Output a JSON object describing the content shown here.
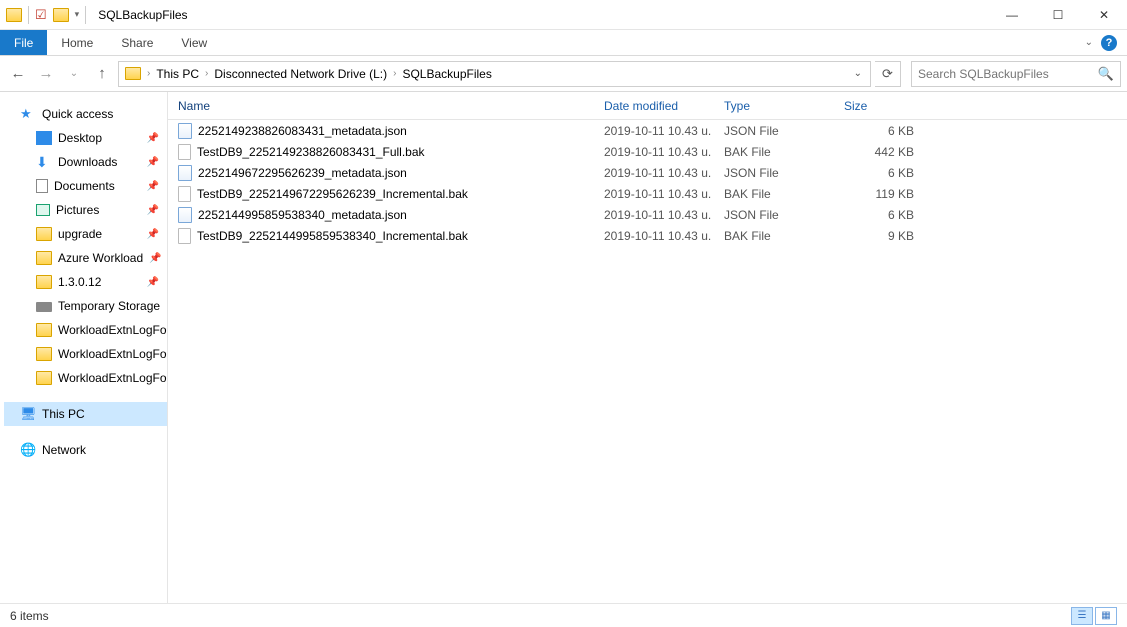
{
  "window": {
    "title": "SQLBackupFiles"
  },
  "ribbon": {
    "tabs": {
      "file": "File",
      "home": "Home",
      "share": "Share",
      "view": "View"
    }
  },
  "breadcrumb": {
    "parts": [
      "This PC",
      "Disconnected Network Drive (L:)",
      "SQLBackupFiles"
    ]
  },
  "search": {
    "placeholder": "Search SQLBackupFiles"
  },
  "tree": {
    "quick_access": "Quick access",
    "desktop": "Desktop",
    "downloads": "Downloads",
    "documents": "Documents",
    "pictures": "Pictures",
    "upgrade": "upgrade",
    "azure": "Azure Workload",
    "ver": "1.3.0.12",
    "temp": "Temporary Storage",
    "wl1": "WorkloadExtnLogFo",
    "wl2": "WorkloadExtnLogFo",
    "wl3": "WorkloadExtnLogFo",
    "this_pc": "This PC",
    "network": "Network"
  },
  "columns": {
    "name": "Name",
    "date": "Date modified",
    "type": "Type",
    "size": "Size"
  },
  "files": [
    {
      "name": "2252149238826083431_metadata.json",
      "date": "2019-10-11 10.43 u.",
      "type": "JSON File",
      "size": "6 KB",
      "icon": "json"
    },
    {
      "name": "TestDB9_2252149238826083431_Full.bak",
      "date": "2019-10-11 10.43 u.",
      "type": "BAK File",
      "size": "442 KB",
      "icon": "bak"
    },
    {
      "name": "2252149672295626239_metadata.json",
      "date": "2019-10-11 10.43 u.",
      "type": "JSON File",
      "size": "6 KB",
      "icon": "json"
    },
    {
      "name": "TestDB9_2252149672295626239_Incremental.bak",
      "date": "2019-10-11 10.43 u.",
      "type": "BAK File",
      "size": "119 KB",
      "icon": "bak"
    },
    {
      "name": "2252144995859538340_metadata.json",
      "date": "2019-10-11 10.43 u.",
      "type": "JSON File",
      "size": "6 KB",
      "icon": "json"
    },
    {
      "name": "TestDB9_2252144995859538340_Incremental.bak",
      "date": "2019-10-11 10.43 u.",
      "type": "BAK File",
      "size": "9 KB",
      "icon": "bak"
    }
  ],
  "status": {
    "text": "6 items"
  }
}
